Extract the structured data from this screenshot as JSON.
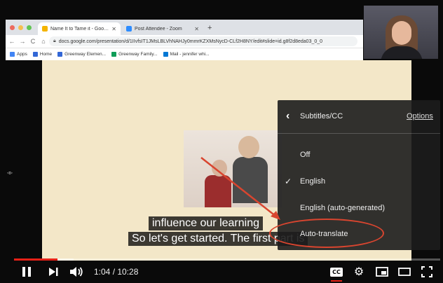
{
  "browser": {
    "tabs": [
      {
        "label": "Name It to Tame it - Google Sli",
        "close": "✕",
        "favicon_color": "#f4b400"
      },
      {
        "label": "Post Attendee - Zoom",
        "close": "✕",
        "favicon_color": "#2d8cff"
      }
    ],
    "new_tab": "+",
    "nav": {
      "back": "←",
      "forward": "→",
      "reload": "C",
      "home": "⌂"
    },
    "url": "docs.google.com/presentation/d/1IIvfsIT1JMsLBLVhNAHJy0mmrKZXMsNycD-CLf2H8NY/edit#slide=id.g8f2d8eda03_0_0",
    "bookmarks": [
      {
        "label": "Apps",
        "color": "#4285f4"
      },
      {
        "label": "Home",
        "color": "#3367d6"
      },
      {
        "label": "Greenway Elemen...",
        "color": "#3367d6"
      },
      {
        "label": "Greenway Family...",
        "color": "#0f9d58"
      },
      {
        "label": "Mail - jennifer whi...",
        "color": "#0078d4"
      }
    ]
  },
  "captions": {
    "line1": "influence our learning",
    "line2": "So let's get started. The first part is"
  },
  "menu": {
    "back": "‹",
    "title": "Subtitles/CC",
    "options_link": "Options",
    "items": [
      {
        "label": "Off",
        "checked": false
      },
      {
        "label": "English",
        "checked": true
      },
      {
        "label": "English (auto-generated)",
        "checked": false
      },
      {
        "label": "Auto-translate",
        "checked": false
      }
    ],
    "check": "✓"
  },
  "player": {
    "time": "1:04 / 10:28",
    "progress_fraction": 0.102,
    "loaded_fraction": 0.14,
    "cc_label": "CC",
    "gear": "⚙",
    "accent": "#e62117"
  },
  "colors": {
    "slide_bg": "#f3e7c8",
    "annotation_red": "#d9452f"
  }
}
